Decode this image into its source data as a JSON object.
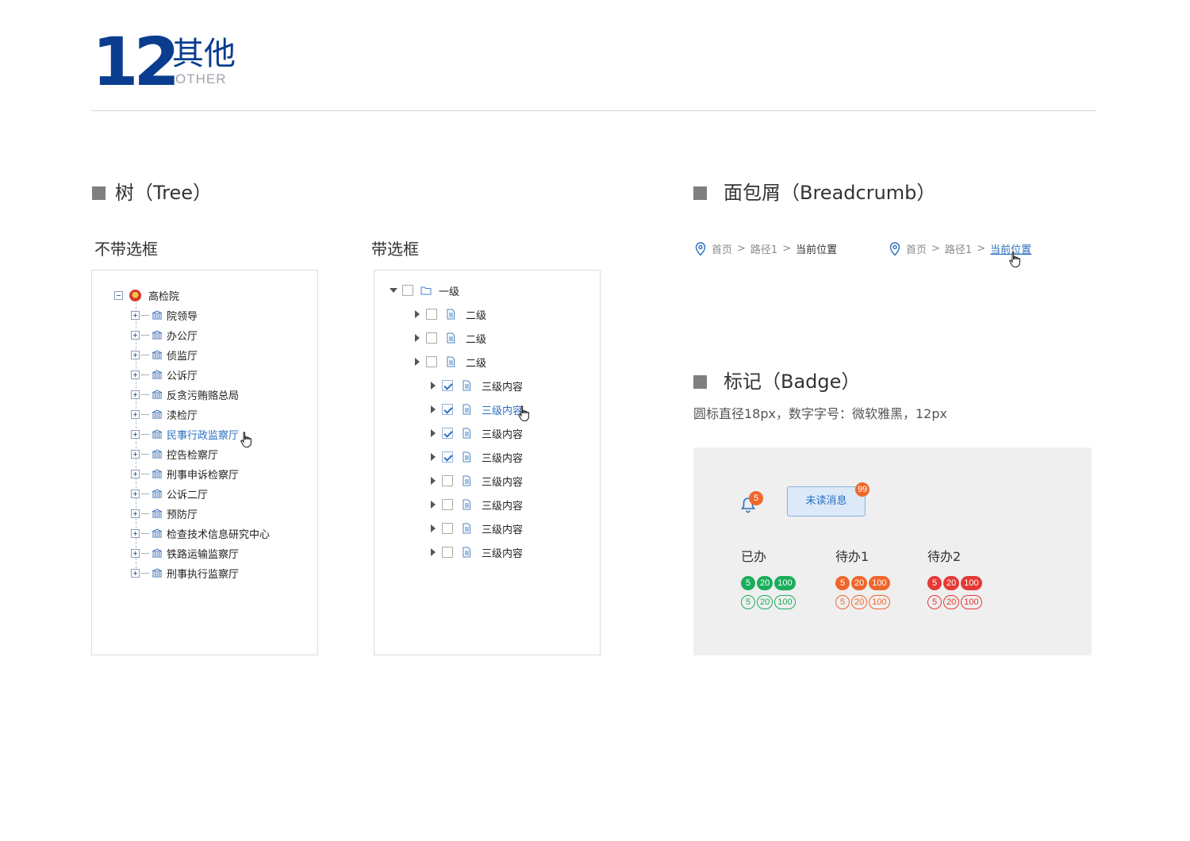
{
  "header": {
    "number": "12",
    "title_cn": "其他",
    "title_en": "OTHER"
  },
  "colors": {
    "brand_blue": "#0a3d8f",
    "link_blue": "#2a6fc1",
    "green": "#1aae5b",
    "orange": "#f0672c",
    "red": "#e53935"
  },
  "tree_section": {
    "title": "树（Tree）",
    "plain": {
      "subtitle": "不带选框",
      "root": {
        "label": "高检院",
        "icon": "emblem-icon",
        "toggle": "minus"
      },
      "children": [
        {
          "label": "院领导",
          "active": false
        },
        {
          "label": "办公厅",
          "active": false
        },
        {
          "label": "侦监厅",
          "active": false
        },
        {
          "label": "公诉厅",
          "active": false
        },
        {
          "label": "反贪污贿赂总局",
          "active": false
        },
        {
          "label": "渎检厅",
          "active": false
        },
        {
          "label": "民事行政监察厅",
          "active": true
        },
        {
          "label": "控告检察厅",
          "active": false
        },
        {
          "label": "刑事申诉检察厅",
          "active": false
        },
        {
          "label": "公诉二厅",
          "active": false
        },
        {
          "label": "预防厅",
          "active": false
        },
        {
          "label": "检查技术信息研究中心",
          "active": false
        },
        {
          "label": "铁路运输监察厅",
          "active": false
        },
        {
          "label": "刑事执行监察厅",
          "active": false
        }
      ]
    },
    "checkbox": {
      "subtitle": "带选框",
      "root": {
        "label": "一级",
        "checked": false,
        "expanded": true,
        "icon": "folder-icon"
      },
      "level2": [
        {
          "label": "二级",
          "checked": false
        },
        {
          "label": "二级",
          "checked": false
        },
        {
          "label": "二级",
          "checked": false
        }
      ],
      "level3": [
        {
          "label": "三级内容",
          "checked": true,
          "active": false
        },
        {
          "label": "三级内容",
          "checked": true,
          "active": true
        },
        {
          "label": "三级内容",
          "checked": true,
          "active": false
        },
        {
          "label": "三级内容",
          "checked": true,
          "active": false
        },
        {
          "label": "三级内容",
          "checked": false,
          "active": false
        },
        {
          "label": "三级内容",
          "checked": false,
          "active": false
        },
        {
          "label": "三级内容",
          "checked": false,
          "active": false
        },
        {
          "label": "三级内容",
          "checked": false,
          "active": false
        }
      ]
    }
  },
  "breadcrumb_section": {
    "title": "面包屑（Breadcrumb）",
    "examples": [
      {
        "items": [
          "首页",
          "路径1"
        ],
        "separator": ">",
        "current": "当前位置",
        "current_state": "default"
      },
      {
        "items": [
          "首页",
          "路径1"
        ],
        "separator": ">",
        "current": "当前位置",
        "current_state": "hover"
      }
    ]
  },
  "badge_section": {
    "title": "标记（Badge）",
    "description": "圆标直径18px，数字字号：微软雅黑，12px",
    "bell": {
      "icon": "bell-icon",
      "count": "5"
    },
    "unread_button": {
      "label": "未读消息",
      "count": "99"
    },
    "groups": [
      {
        "label": "已办",
        "color": "#1aae5b",
        "values": [
          "5",
          "20",
          "100"
        ]
      },
      {
        "label": "待办1",
        "color": "#f0672c",
        "values": [
          "5",
          "20",
          "100"
        ]
      },
      {
        "label": "待办2",
        "color": "#e53935",
        "values": [
          "5",
          "20",
          "100"
        ]
      }
    ]
  }
}
